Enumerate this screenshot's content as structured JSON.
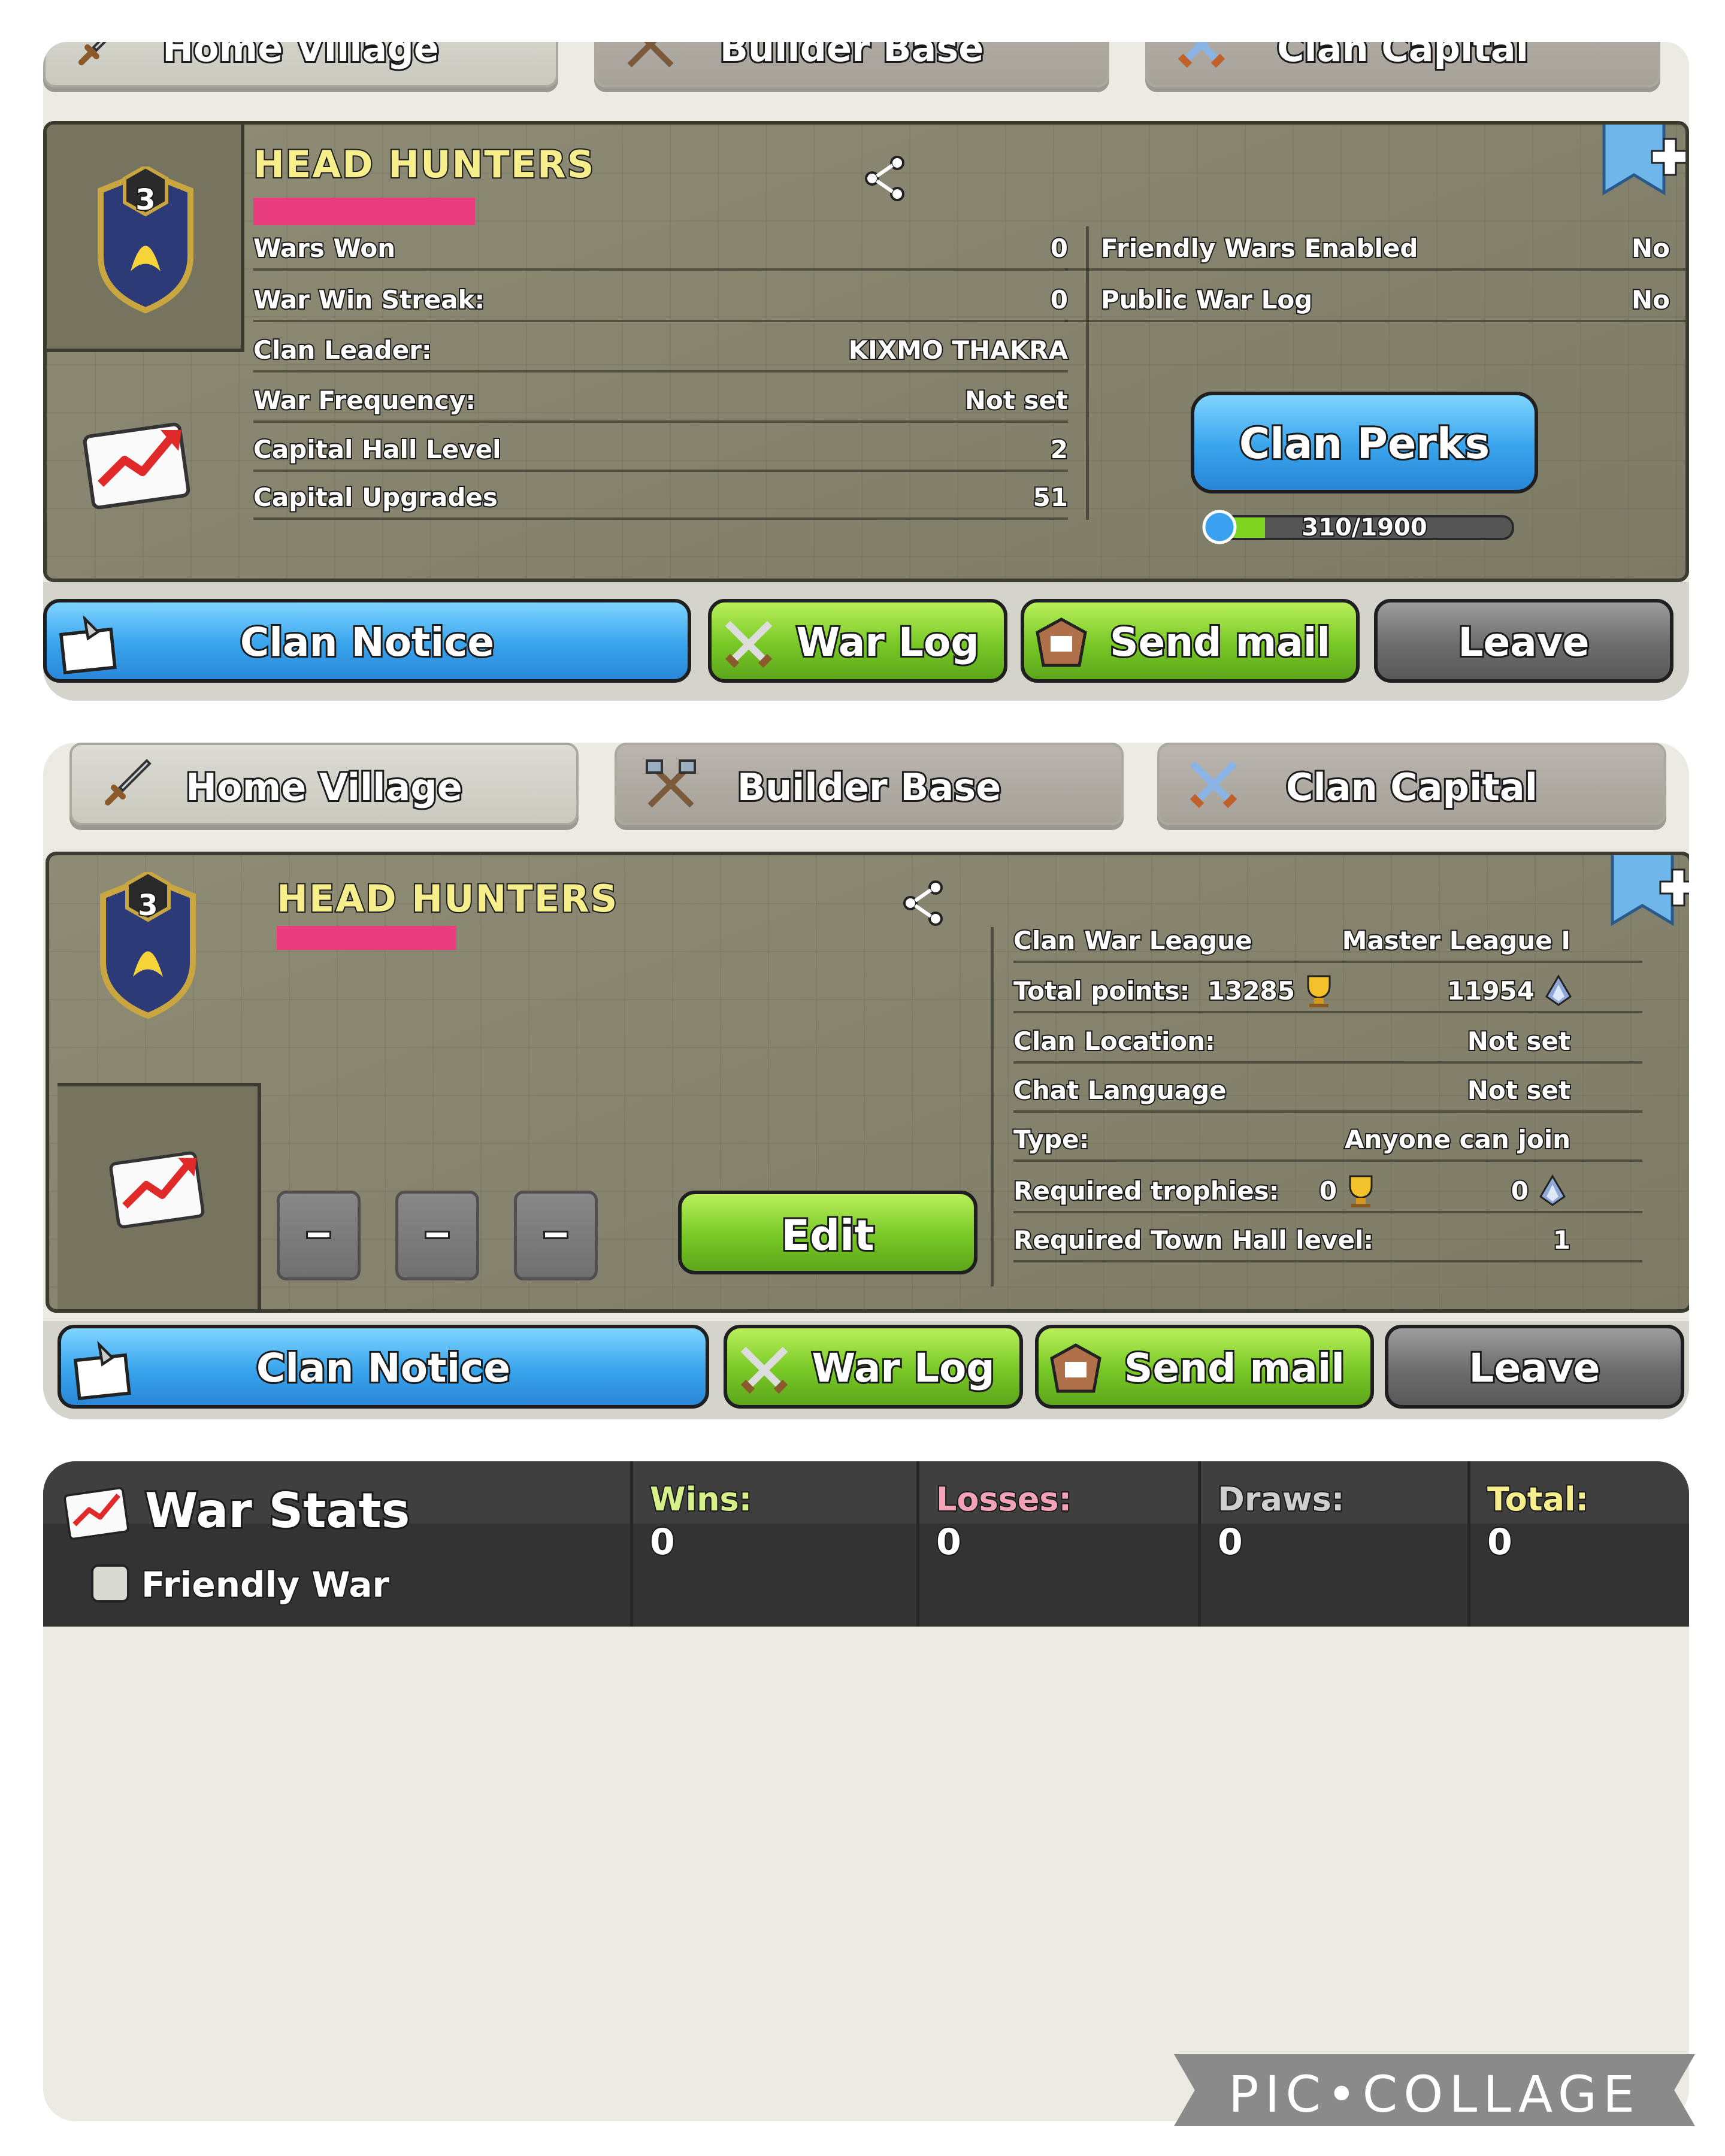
{
  "top_card": {
    "tabs": [
      {
        "label": "Home Village",
        "icon": "sword-icon"
      },
      {
        "label": "Builder Base",
        "icon": "crossed-axes-icon"
      },
      {
        "label": "Clan Capital",
        "icon": "crossed-swords-icon"
      }
    ],
    "clan_name": "HEAD HUNTERS",
    "clan_level": "3",
    "stats_left": [
      {
        "label": "Wars Won",
        "value": "0"
      },
      {
        "label": "War Win Streak:",
        "value": "0"
      },
      {
        "label": "Clan Leader:",
        "value": "KIXMO THAKRA"
      },
      {
        "label": "War Frequency:",
        "value": "Not set"
      },
      {
        "label": "Capital Hall Level",
        "value": "2"
      },
      {
        "label": "Capital Upgrades",
        "value": "51"
      }
    ],
    "stats_right": [
      {
        "label": "Friendly Wars Enabled",
        "value": "No"
      },
      {
        "label": "Public War Log",
        "value": "No"
      }
    ],
    "clan_perks_label": "Clan Perks",
    "perks_progress": "310/1900",
    "perks_fraction": 0.163,
    "buttons": {
      "notice": "Clan Notice",
      "warlog": "War Log",
      "mail": "Send mail",
      "leave": "Leave"
    }
  },
  "bottom_card": {
    "tabs": [
      {
        "label": "Home Village",
        "icon": "sword-icon"
      },
      {
        "label": "Builder Base",
        "icon": "crossed-axes-icon"
      },
      {
        "label": "Clan Capital",
        "icon": "crossed-swords-icon"
      }
    ],
    "clan_name": "HEAD HUNTERS",
    "clan_level": "3",
    "info": [
      {
        "label": "Clan War League",
        "value": "Master League I"
      },
      {
        "label": "Total points:",
        "value1": "13285",
        "value2": "11954"
      },
      {
        "label": "Clan Location:",
        "value": "Not set"
      },
      {
        "label": "Chat Language",
        "value": "Not set"
      },
      {
        "label": "Type:",
        "value": "Anyone can join"
      },
      {
        "label": "Required trophies:",
        "value1": "0",
        "value2": "0"
      },
      {
        "label": "Required Town Hall level:",
        "value": "1"
      }
    ],
    "edit_label": "Edit",
    "dash": "–",
    "buttons": {
      "notice": "Clan Notice",
      "warlog": "War Log",
      "mail": "Send mail",
      "leave": "Leave"
    }
  },
  "war_stats": {
    "title": "War Stats",
    "friendly_label": "Friendly War",
    "friendly_checked": false,
    "columns": [
      {
        "label": "Wins:",
        "value": "0",
        "color": "#d6f08a"
      },
      {
        "label": "Losses:",
        "value": "0",
        "color": "#f3a3b8"
      },
      {
        "label": "Draws:",
        "value": "0",
        "color": "#cfcfcf"
      },
      {
        "label": "Total:",
        "value": "0",
        "color": "#f6ef8c"
      }
    ]
  },
  "watermark": "PIC•COLLAGE"
}
